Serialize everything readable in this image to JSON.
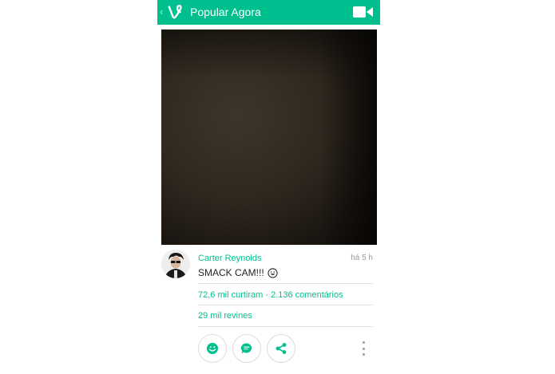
{
  "app_bar": {
    "title": "Popular Agora",
    "back_icon": "chevron-left-icon",
    "logo_icon": "vine-logo-icon",
    "camera_icon": "video-camera-icon",
    "background_color": "#00bf8f"
  },
  "post": {
    "author": "Carter Reynolds",
    "time_ago": "há 5 h",
    "caption": "SMACK CAM!!!",
    "caption_emoji": "grinning-face-icon",
    "likes": "72,6 mil curtiram",
    "stats_separator": "·",
    "comments": "2.136 comentários",
    "revines": "29 mil revines"
  },
  "actions": [
    {
      "name": "like",
      "icon": "smiley-icon"
    },
    {
      "name": "comment",
      "icon": "chat-bubble-icon"
    },
    {
      "name": "share",
      "icon": "share-icon"
    },
    {
      "name": "more",
      "icon": "more-vertical-icon"
    }
  ],
  "colors": {
    "accent": "#00bf8f",
    "muted_text": "#9a9a9a",
    "body_text": "#222222"
  }
}
